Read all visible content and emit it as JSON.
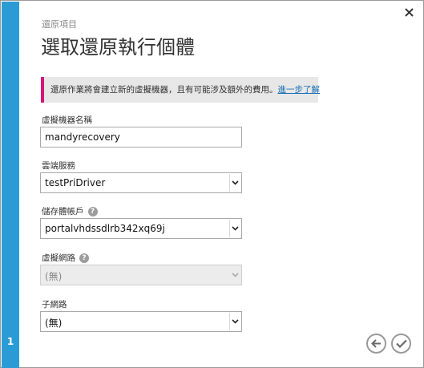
{
  "wizard": {
    "step_number": "1",
    "breadcrumb": "還原項目",
    "title": "選取還原執行個體",
    "notice_text": "還原作業將會建立新的虛擬機器，且有可能涉及額外的費用。",
    "notice_link": "進一步了解"
  },
  "fields": {
    "vm_name": {
      "label": "虛擬機器名稱",
      "value": "mandyrecovery"
    },
    "cloud_service": {
      "label": "雲端服務",
      "value": "testPriDriver"
    },
    "storage_account": {
      "label": "儲存體帳戶",
      "value": "portalvhdssdlrb342xq69j",
      "help": "?"
    },
    "virtual_network": {
      "label": "虛擬網路",
      "value": "(無)",
      "help": "?"
    },
    "subnet": {
      "label": "子網路",
      "value": "(無)"
    }
  },
  "colors": {
    "step_bar": "#2b9bd6",
    "notice_accent": "#d6157a",
    "link": "#1a6fb5"
  },
  "icons": {
    "close": "close-icon",
    "back": "arrow-left-icon",
    "finish": "check-icon",
    "dropdown": "chevron-down-icon",
    "help": "help-icon"
  }
}
